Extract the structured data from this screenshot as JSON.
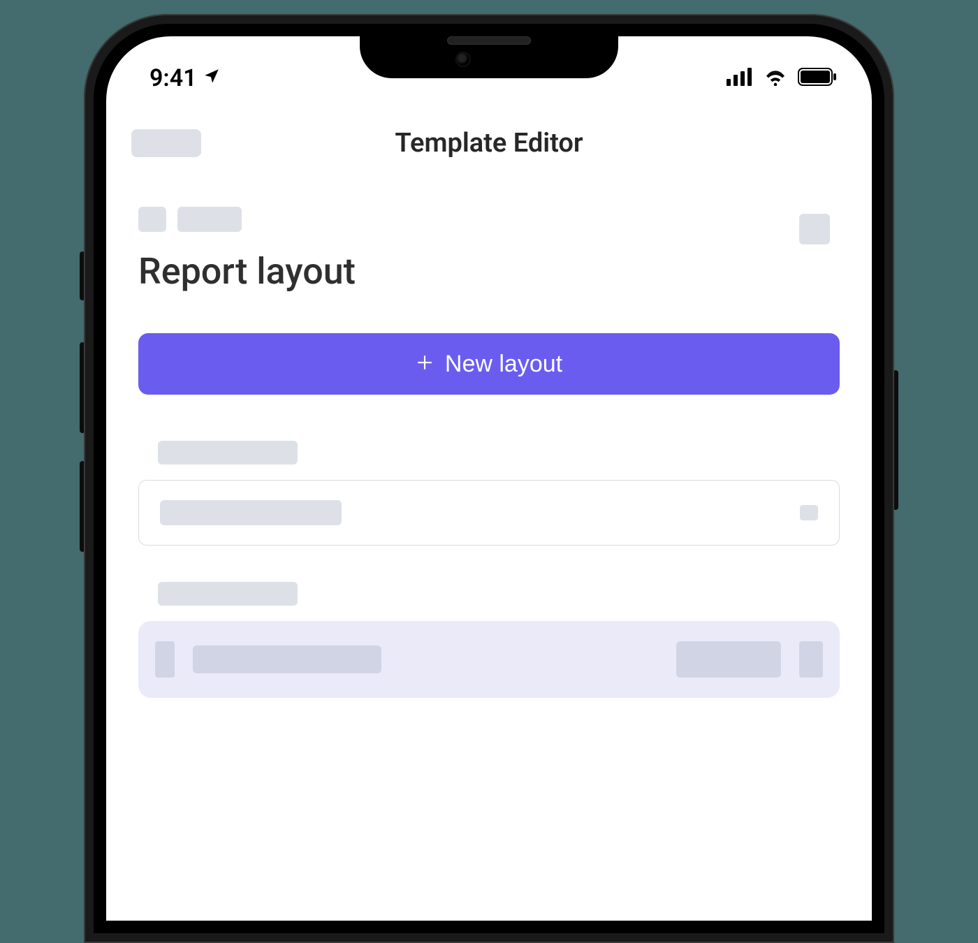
{
  "status": {
    "time": "9:41"
  },
  "nav": {
    "title": "Template Editor"
  },
  "section": {
    "title": "Report layout"
  },
  "actions": {
    "new_layout": "New layout"
  },
  "colors": {
    "accent": "#6b5cf0"
  }
}
